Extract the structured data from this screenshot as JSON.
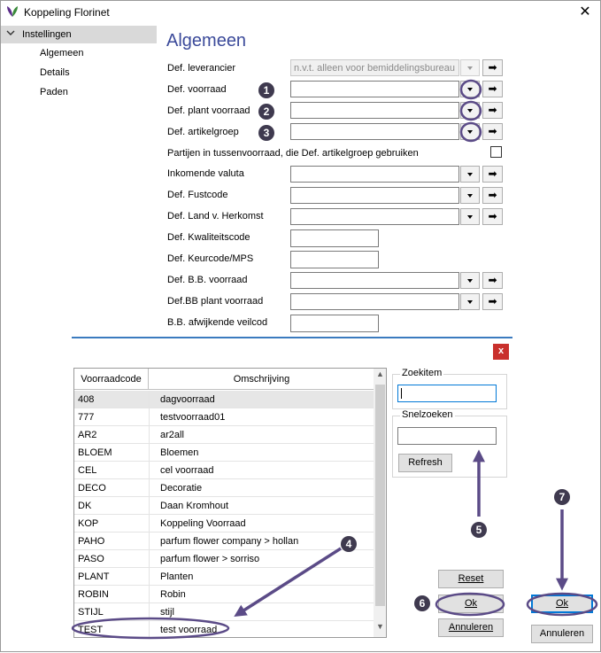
{
  "window": {
    "title": "Koppeling Florinet",
    "close_glyph": "✕"
  },
  "sidebar": {
    "root": {
      "label": "Instellingen",
      "expanded": true
    },
    "items": [
      {
        "label": "Algemeen"
      },
      {
        "label": "Details"
      },
      {
        "label": "Paden"
      }
    ]
  },
  "main": {
    "title": "Algemeen",
    "fields": {
      "leverancier": {
        "label": "Def. leverancier",
        "value": "n.v.t. alleen voor bemiddelingsbureau",
        "disabled": true
      },
      "voorraad": {
        "label": "Def. voorraad",
        "value": ""
      },
      "plant_voorraad": {
        "label": "Def. plant voorraad",
        "value": ""
      },
      "artikelgroep": {
        "label": "Def. artikelgroep",
        "value": ""
      },
      "partijen": {
        "label": "Partijen in tussenvoorraad, die Def. artikelgroep gebruiken",
        "checked": false
      },
      "valuta": {
        "label": "Inkomende valuta",
        "value": ""
      },
      "fustcode": {
        "label": "Def. Fustcode",
        "value": ""
      },
      "land": {
        "label": "Def. Land v. Herkomst",
        "value": ""
      },
      "kwaliteitscode": {
        "label": "Def. Kwaliteitscode",
        "value": ""
      },
      "keurcode": {
        "label": "Def. Keurcode/MPS",
        "value": ""
      },
      "bb_voorraad": {
        "label": "Def. B.B. voorraad",
        "value": ""
      },
      "bb_plant": {
        "label": "Def.BB plant voorraad",
        "value": ""
      },
      "bb_veilcod": {
        "label": "B.B. afwijkende veilcod",
        "value": ""
      }
    },
    "arrow_glyph": "➡"
  },
  "picker": {
    "close_glyph": "x",
    "columns": [
      "Voorraadcode",
      "Omschrijving"
    ],
    "rows": [
      [
        "408",
        "dagvoorraad"
      ],
      [
        "777",
        "testvoorraad01"
      ],
      [
        "AR2",
        "ar2all"
      ],
      [
        "BLOEM",
        "Bloemen"
      ],
      [
        "CEL",
        "cel voorraad"
      ],
      [
        "DECO",
        "Decoratie"
      ],
      [
        "DK",
        "Daan Kromhout"
      ],
      [
        "KOP",
        "Koppeling Voorraad"
      ],
      [
        "PAHO",
        "parfum flower company > hollan"
      ],
      [
        "PASO",
        "parfum flower > sorriso"
      ],
      [
        "PLANT",
        "Planten"
      ],
      [
        "ROBIN",
        "Robin"
      ],
      [
        "STIJL",
        "stijl"
      ],
      [
        "TEST",
        "test voorraad"
      ]
    ],
    "selected_row": 0,
    "zoekitem": {
      "label": "Zoekitem",
      "value": ""
    },
    "snelzoeken": {
      "label": "Snelzoeken",
      "value": ""
    },
    "refresh_label": "Refresh",
    "reset_label": "Reset",
    "ok_label": "Ok",
    "cancel_label": "Annuleren"
  },
  "footer": {
    "ok_label": "Ok",
    "cancel_label": "Annuleren"
  },
  "annotations": {
    "color": "#5b4b87",
    "numbers": [
      "1",
      "2",
      "3",
      "4",
      "5",
      "6",
      "7"
    ]
  }
}
